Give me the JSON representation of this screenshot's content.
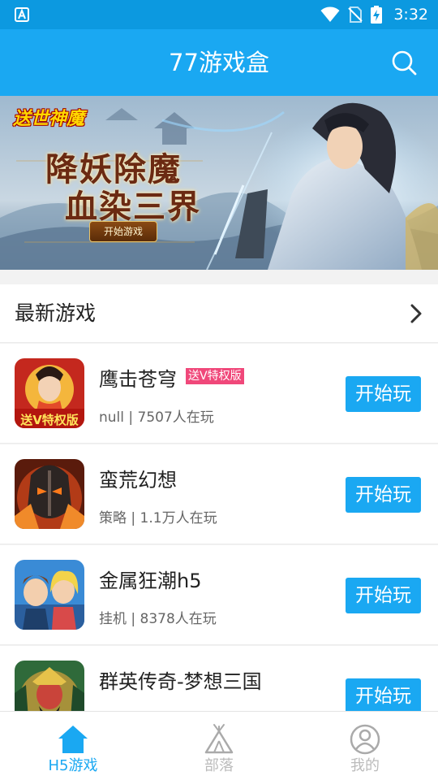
{
  "status_bar": {
    "time": "3:32"
  },
  "header": {
    "title": "77游戏盒"
  },
  "banner": {
    "logo_text": "送世神魔",
    "title_line1": "降妖除魔",
    "title_line2": "血染三界",
    "button_label": "开始游戏"
  },
  "section": {
    "title": "最新游戏"
  },
  "games": [
    {
      "name": "鹰击苍穹",
      "tag": "送V特权版",
      "meta": "null | 7507人在玩",
      "button": "开始玩"
    },
    {
      "name": "蛮荒幻想",
      "tag": "",
      "meta": "策略 | 1.1万人在玩",
      "button": "开始玩"
    },
    {
      "name": "金属狂潮h5",
      "tag": "",
      "meta": "挂机 | 8378人在玩",
      "button": "开始玩"
    },
    {
      "name": "群英传奇-梦想三国",
      "tag": "",
      "meta": "",
      "button": "开始玩"
    }
  ],
  "nav": {
    "items": [
      {
        "label": "H5游戏",
        "icon": "home-icon",
        "active": true
      },
      {
        "label": "部落",
        "icon": "tent-icon",
        "active": false
      },
      {
        "label": "我的",
        "icon": "user-icon",
        "active": false
      }
    ]
  },
  "colors": {
    "primary": "#1aa8f2",
    "status_bar": "#0c99e0",
    "tag": "#f0487a"
  }
}
